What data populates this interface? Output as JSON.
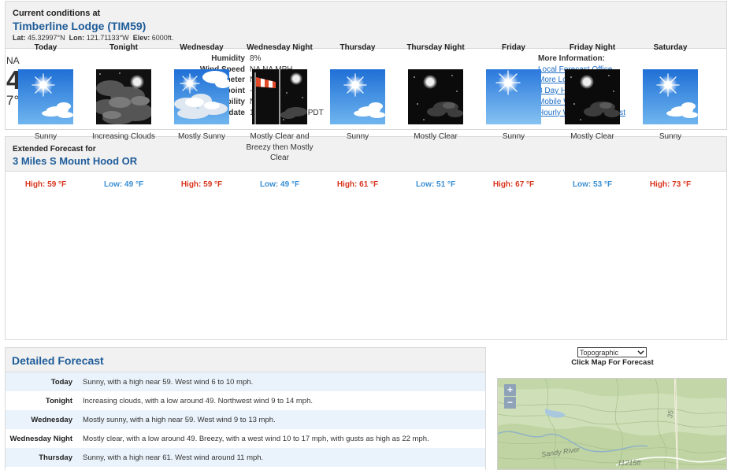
{
  "current": {
    "label": "Current conditions at",
    "station": "Timberline Lodge (TIM59)",
    "lat_label": "Lat:",
    "lat": "45.32997°N",
    "lon_label": "Lon:",
    "lon": "121.71133°W",
    "elev_label": "Elev:",
    "elev": "6000ft.",
    "condition": "NA",
    "temp_f": "45°F",
    "temp_c": "7°C",
    "details": [
      {
        "key": "Humidity",
        "value": "8%"
      },
      {
        "key": "Wind Speed",
        "value": "NA NA MPH"
      },
      {
        "key": "Barometer",
        "value": "NA"
      },
      {
        "key": "Dewpoint",
        "value": "-11°F (-24°C)"
      },
      {
        "key": "Visibility",
        "value": "NA"
      },
      {
        "key": "Last update",
        "value": "11 Jul 05:00 AM PDT"
      }
    ],
    "more_info_title": "More Information:",
    "links": [
      "Local Forecast Office",
      "More Local Wx",
      "3 Day History",
      "Mobile Weather",
      "Hourly Weather Forecast"
    ]
  },
  "extended": {
    "label": "Extended Forecast for",
    "location": "3 Miles S Mount Hood OR",
    "periods": [
      {
        "name": "Today",
        "short": "Sunny",
        "temp": "High: 59 °F",
        "kind": "high",
        "icon": "sunny-icon"
      },
      {
        "name": "Tonight",
        "short": "Increasing Clouds",
        "temp": "Low: 49 °F",
        "kind": "low",
        "icon": "increasing-clouds-icon"
      },
      {
        "name": "Wednesday",
        "short": "Mostly Sunny",
        "temp": "High: 59 °F",
        "kind": "high",
        "icon": "mostly-sunny-icon"
      },
      {
        "name": "Wednesday Night",
        "short": "Mostly Clear and Breezy then Mostly Clear",
        "temp": "Low: 49 °F",
        "kind": "low",
        "icon": "windy-night-icon"
      },
      {
        "name": "Thursday",
        "short": "Sunny",
        "temp": "High: 61 °F",
        "kind": "high",
        "icon": "sunny-icon"
      },
      {
        "name": "Thursday Night",
        "short": "Mostly Clear",
        "temp": "Low: 51 °F",
        "kind": "low",
        "icon": "mostly-clear-night-icon"
      },
      {
        "name": "Friday",
        "short": "Sunny",
        "temp": "High: 67 °F",
        "kind": "high",
        "icon": "clear-sunny-icon"
      },
      {
        "name": "Friday Night",
        "short": "Mostly Clear",
        "temp": "Low: 53 °F",
        "kind": "low",
        "icon": "mostly-clear-night-icon"
      },
      {
        "name": "Saturday",
        "short": "Sunny",
        "temp": "High: 73 °F",
        "kind": "high",
        "icon": "sunny-icon"
      }
    ]
  },
  "detailed": {
    "title": "Detailed Forecast",
    "rows": [
      {
        "label": "Today",
        "text": "Sunny, with a high near 59. West wind 6 to 10 mph."
      },
      {
        "label": "Tonight",
        "text": "Increasing clouds, with a low around 49. Northwest wind 9 to 14 mph."
      },
      {
        "label": "Wednesday",
        "text": "Mostly sunny, with a high near 59. West wind 9 to 13 mph."
      },
      {
        "label": "Wednesday Night",
        "text": "Mostly clear, with a low around 49. Breezy, with a west wind 10 to 17 mph, with gusts as high as 22 mph."
      },
      {
        "label": "Thursday",
        "text": "Sunny, with a high near 61. West wind around 11 mph."
      }
    ]
  },
  "map": {
    "select_value": "Topographic",
    "caption": "Click Map For Forecast",
    "zoom_in": "+",
    "zoom_out": "−",
    "labels": [
      "Sandy River",
      "11215ft",
      "35"
    ]
  },
  "colors": {
    "accent": "#1e5c99",
    "link": "#1e6ec6",
    "high": "#d9341d",
    "low": "#3a8fd4",
    "panel_head": "#f1f1f1",
    "row_stripe": "#eaf3fb"
  }
}
